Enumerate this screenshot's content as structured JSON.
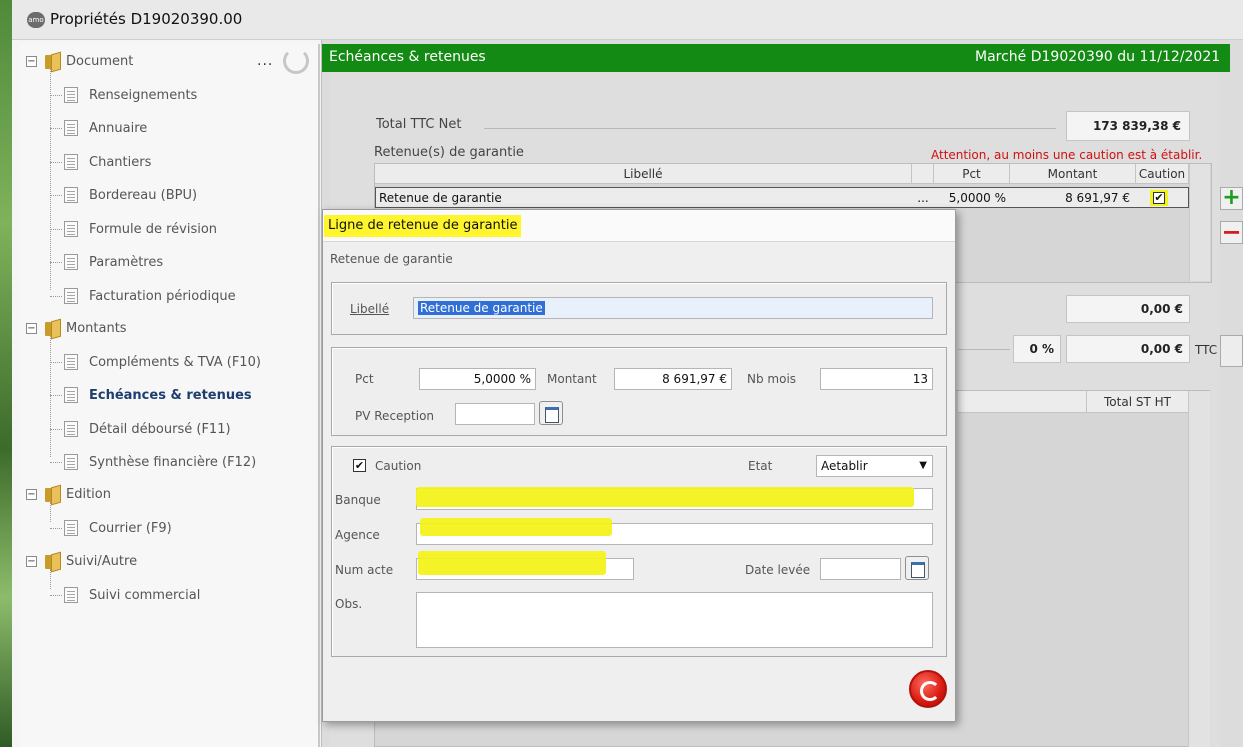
{
  "window": {
    "title": "Propriétés D19020390.00",
    "app_icon": "app-logo-icon"
  },
  "sidebar": {
    "groups": [
      {
        "label": "Document",
        "items": [
          "Renseignements",
          "Annuaire",
          "Chantiers",
          "Bordereau (BPU)",
          "Formule de révision",
          "Paramètres",
          "Facturation périodique"
        ]
      },
      {
        "label": "Montants",
        "items": [
          "Compléments & TVA (F10)",
          "Echéances & retenues",
          "Détail déboursé (F11)",
          "Synthèse financière (F12)"
        ]
      },
      {
        "label": "Edition",
        "items": [
          "Courrier (F9)"
        ]
      },
      {
        "label": "Suivi/Autre",
        "items": [
          "Suivi commercial"
        ]
      }
    ],
    "active_item": "Echéances & retenues",
    "ellipsis": "...",
    "toggle_symbol": "⊟"
  },
  "header": {
    "title": "Echéances & retenues",
    "right": "Marché D19020390 du 11/12/2021",
    "color": "#138a13"
  },
  "main": {
    "total_label": "Total TTC Net",
    "total_value": "173 839,38 €",
    "retenue_label": "Retenue(s) de garantie",
    "warning": "Attention, au moins une caution est à établir.",
    "grid": {
      "columns": [
        "Libellé",
        "Pct",
        "Montant",
        "Caution"
      ],
      "rows": [
        {
          "libelle": "Retenue de garantie",
          "dots": "...",
          "pct": "5,0000 %",
          "montant": "8 691,97 €",
          "caution_checked": true
        }
      ]
    },
    "amount_box_1": "0,00 €",
    "pct_box": "0 %",
    "amount_box_2": "0,00 €",
    "ttc_label": "TTC",
    "bottom_column": "Total ST HT",
    "plus_symbol": "+",
    "minus_symbol": "−"
  },
  "dialog": {
    "title": "Ligne de retenue de garantie",
    "subtitle": "Retenue de garantie",
    "libelle_label": "Libellé",
    "libelle_value": "Retenue de garantie",
    "pct_label": "Pct",
    "pct_value": "5,0000 %",
    "montant_label": "Montant",
    "montant_value": "8 691,97 €",
    "nbmois_label": "Nb mois",
    "nbmois_value": "13",
    "pv_label": "PV Reception",
    "pv_value": "",
    "caution_label": "Caution",
    "caution_checked": true,
    "etat_label": "Etat",
    "etat_value": "Aetablir",
    "banque_label": "Banque",
    "agence_label": "Agence",
    "numacte_label": "Num acte",
    "datelevee_label": "Date levée",
    "obs_label": "Obs.",
    "highlight_color": "#f2f21c"
  }
}
